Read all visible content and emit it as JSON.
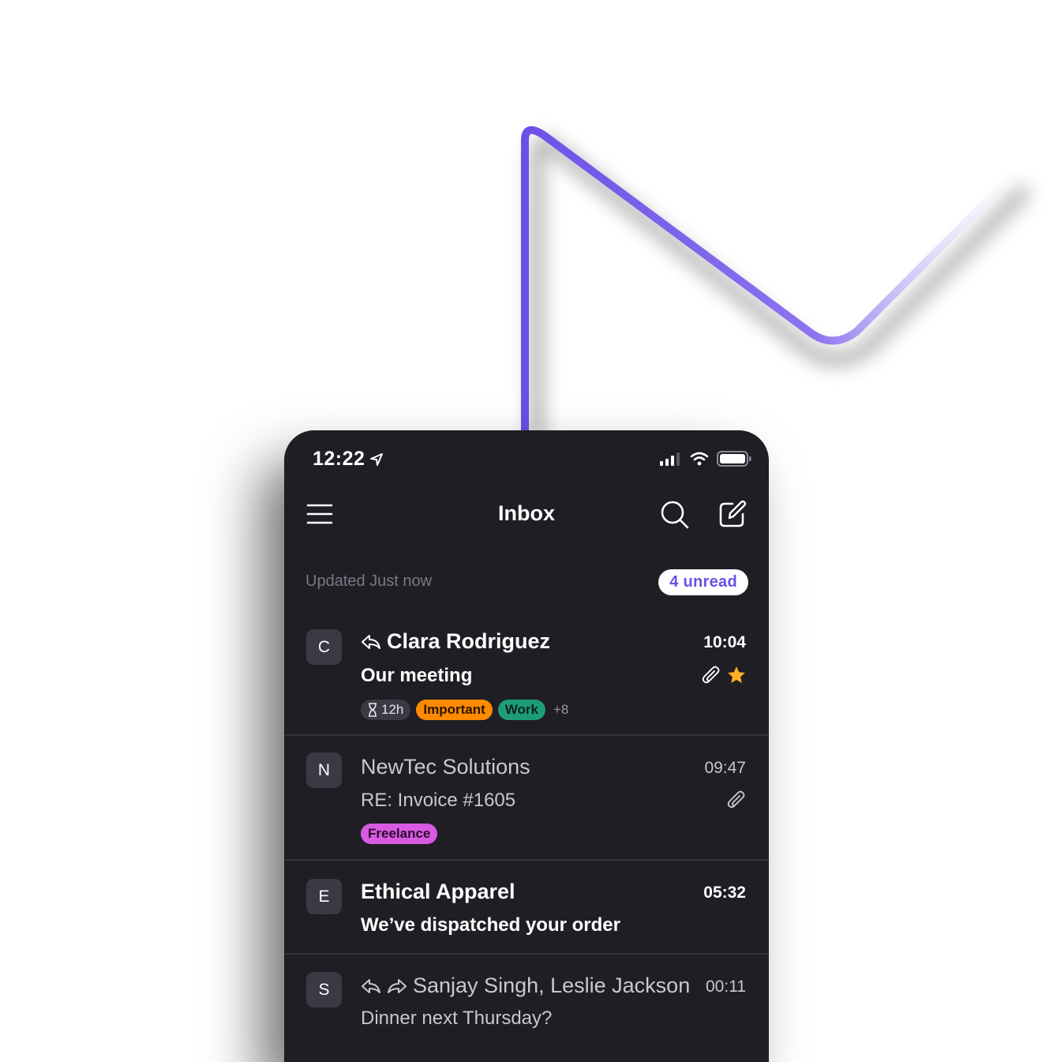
{
  "status_bar": {
    "time": "12:22"
  },
  "header": {
    "title": "Inbox"
  },
  "summary": {
    "updated": "Updated Just now",
    "unread_badge": "4 unread"
  },
  "messages": [
    {
      "initial": "C",
      "sender": "Clara Rodriguez",
      "time": "10:04",
      "subject": "Our meeting",
      "unread": true,
      "icons": [
        "reply-icon",
        "attachment-icon",
        "star-icon"
      ],
      "tags": {
        "timer": "12h",
        "labels": [
          "Important",
          "Work"
        ],
        "more": "+8"
      }
    },
    {
      "initial": "N",
      "sender": "NewTec Solutions",
      "time": "09:47",
      "subject": "RE: Invoice #1605",
      "unread": false,
      "icons": [
        "attachment-icon"
      ],
      "tags": {
        "labels": [
          "Freelance"
        ]
      }
    },
    {
      "initial": "E",
      "sender": "Ethical Apparel",
      "time": "05:32",
      "subject": "We’ve dispatched your order",
      "unread": true,
      "icons": []
    },
    {
      "initial": "S",
      "sender": "Sanjay Singh, Leslie Jackson",
      "time": "00:11",
      "subject": "Dinner next Thursday?",
      "unread": false,
      "icons": [
        "reply-icon",
        "forward-icon"
      ]
    }
  ],
  "colors": {
    "accent": "#6b4fe8",
    "background": "#1f1e24",
    "important": "#ff8a00",
    "work": "#1e9b78",
    "freelance": "#d75ae0",
    "star": "#ffb020"
  }
}
